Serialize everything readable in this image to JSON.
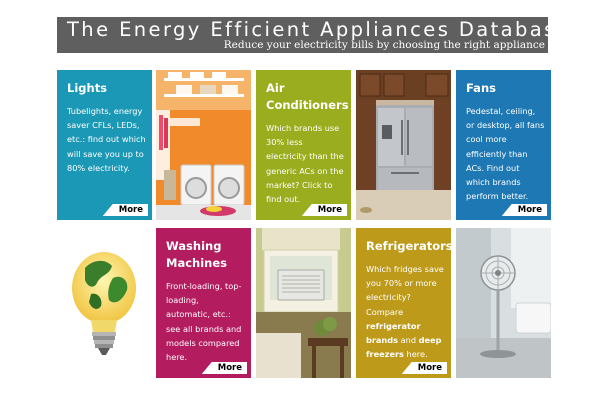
{
  "header": {
    "title": "The Energy Efficient Appliances Database",
    "subtitle": "Reduce your electricity bills by choosing the right appliance"
  },
  "tiles": [
    {
      "title": "Lights",
      "text": "Tubelights, energy saver CFLs, LEDs, etc.: find out which will save you up to 80% electricity.",
      "more": "More",
      "color": "#1b98b5"
    },
    {
      "title": "Air Conditioners",
      "text": "Which brands use 30% less electricity than the generic ACs on the market? Click to find out.",
      "more": "More",
      "color": "#99ad1e"
    },
    {
      "title": "Fans",
      "text": "Pedestal, ceiling, or desktop, all fans cool more efficiently than ACs. Find out which brands perform better.",
      "more": "More",
      "color": "#1e78b4"
    },
    {
      "title": "Washing Machines",
      "text": "Front-loading, top-loading, automatic, etc.: see all brands and models compared here.",
      "more": "More",
      "color": "#b31c5e"
    },
    {
      "title": "Refrigerators",
      "text_pre": "Which fridges save you 70% or more electricity? Compare",
      "text_bold1": "refrigerator brands",
      "text_and": "and",
      "text_bold2": "deep freezers",
      "text_post": "here.",
      "more": "More",
      "color": "#bd9a1a"
    }
  ],
  "photos": [
    {
      "icon": "laundry-room-photo"
    },
    {
      "icon": "refrigerator-kitchen-photo"
    },
    {
      "icon": "globe-lightbulb-photo"
    },
    {
      "icon": "window-ac-room-photo"
    },
    {
      "icon": "pedestal-fan-photo"
    }
  ]
}
